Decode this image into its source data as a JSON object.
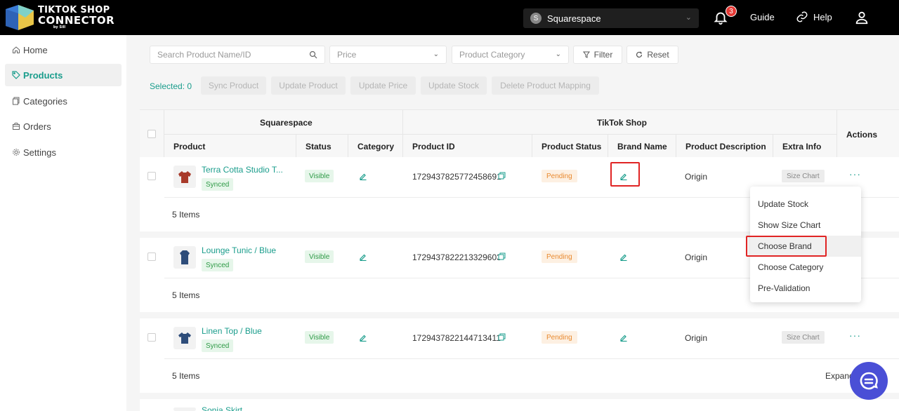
{
  "header": {
    "logo_line1": "TIKTOK SHOP",
    "logo_line2": "CONNECTOR",
    "logo_line3": "by Sill",
    "store_avatar_letter": "S",
    "store_name": "Squarespace",
    "notification_count": "3",
    "guide_label": "Guide",
    "help_label": "Help"
  },
  "sidebar": {
    "items": [
      {
        "label": "Home",
        "icon": "home-icon"
      },
      {
        "label": "Products",
        "icon": "tag-icon"
      },
      {
        "label": "Categories",
        "icon": "copy-icon"
      },
      {
        "label": "Orders",
        "icon": "package-icon"
      },
      {
        "label": "Settings",
        "icon": "gear-icon"
      }
    ],
    "active": "Products"
  },
  "filters": {
    "search_placeholder": "Search Product Name/ID",
    "price_placeholder": "Price",
    "category_placeholder": "Product Category",
    "filter_label": "Filter",
    "reset_label": "Reset"
  },
  "bulk": {
    "selected_label": "Selected: 0",
    "sync_product": "Sync Product",
    "update_product": "Update Product",
    "update_price": "Update Price",
    "update_stock": "Update Stock",
    "delete_mapping": "Delete Product Mapping"
  },
  "table": {
    "group_squarespace": "Squarespace",
    "group_tiktok": "TikTok Shop",
    "actions": "Actions",
    "columns": {
      "product": "Product",
      "status": "Status",
      "category": "Category",
      "product_id": "Product ID",
      "product_status": "Product Status",
      "brand_name": "Brand Name",
      "product_description": "Product Description",
      "extra_info": "Extra Info"
    },
    "rows": [
      {
        "name": "Terra Cotta Studio T...",
        "sync": "Synced",
        "status": "Visible",
        "product_id": "1729437825772458691",
        "product_status": "Pending",
        "description": "Origin",
        "extra": "Size Chart",
        "items": "5 Items"
      },
      {
        "name": "Lounge Tunic / Blue",
        "sync": "Synced",
        "status": "Visible",
        "product_id": "1729437822213329603",
        "product_status": "Pending",
        "description": "Origin",
        "extra": "",
        "items": "5 Items"
      },
      {
        "name": "Linen Top / Blue",
        "sync": "Synced",
        "status": "Visible",
        "product_id": "1729437822144713411",
        "product_status": "Pending",
        "description": "Origin",
        "extra": "Size Chart",
        "items": "5 Items",
        "expand": "Expand"
      },
      {
        "name": "Sonja Skirt",
        "sync": "",
        "status": "",
        "product_id": "",
        "product_status": "",
        "description": "",
        "extra": "",
        "items": ""
      }
    ]
  },
  "dropdown": {
    "items": [
      "Update Stock",
      "Show Size Chart",
      "Choose Brand",
      "Choose Category",
      "Pre-Validation"
    ],
    "highlighted": "Choose Brand"
  },
  "colors": {
    "accent": "#1a9d8c",
    "header_bg": "#000000",
    "highlight_box": "#e02424",
    "chat_fab": "#4a4fd6"
  }
}
